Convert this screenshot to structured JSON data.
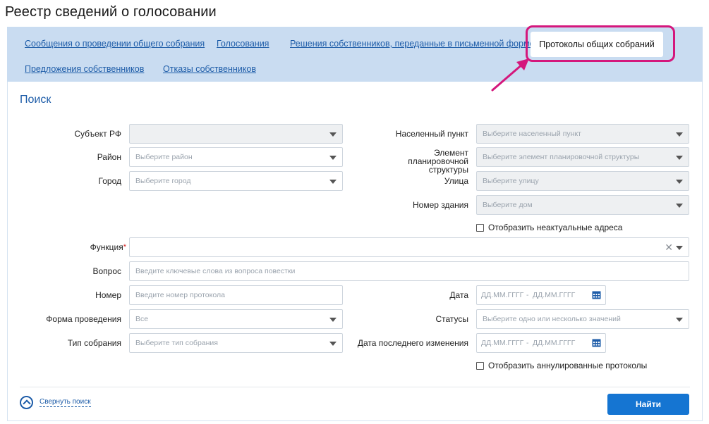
{
  "page": {
    "title": "Реестр сведений о голосовании"
  },
  "tabs": {
    "items": [
      {
        "label": "Сообщения о проведении общего собрания"
      },
      {
        "label": "Голосования"
      },
      {
        "label": "Решения собственников, переданные в письменной форме"
      },
      {
        "label": "Протоколы общих собраний",
        "active": true
      },
      {
        "label": "Предложения собственников"
      },
      {
        "label": "Отказы собственников"
      }
    ]
  },
  "search": {
    "title": "Поиск",
    "fields": {
      "subject": {
        "label": "Субъект РФ",
        "placeholder": ""
      },
      "district": {
        "label": "Район",
        "placeholder": "Выберите район"
      },
      "city": {
        "label": "Город",
        "placeholder": "Выберите город"
      },
      "settlement": {
        "label": "Населенный пункт",
        "placeholder": "Выберите населенный пункт"
      },
      "planning": {
        "label": "Элемент планировочной структуры",
        "placeholder": "Выберите элемент планировочной структуры"
      },
      "street": {
        "label": "Улица",
        "placeholder": "Выберите улицу"
      },
      "building": {
        "label": "Номер здания",
        "placeholder": "Выберите дом"
      },
      "function": {
        "label": "Функция",
        "required_mark": "*",
        "value": ""
      },
      "question": {
        "label": "Вопрос",
        "placeholder": "Введите ключевые слова из вопроса повестки"
      },
      "number": {
        "label": "Номер",
        "placeholder": "Введите номер протокола"
      },
      "date": {
        "label": "Дата",
        "from_placeholder": "ДД.ММ.ГГГГ",
        "separator": "-",
        "to_placeholder": "ДД.ММ.ГГГГ"
      },
      "form": {
        "label": "Форма проведения",
        "value": "Все"
      },
      "statuses": {
        "label": "Статусы",
        "placeholder": "Выберите одно или несколько значений"
      },
      "meeting_type": {
        "label": "Тип собрания",
        "placeholder": "Выберите тип собрания"
      },
      "last_change": {
        "label": "Дата последнего изменения",
        "from_placeholder": "ДД.ММ.ГГГГ",
        "separator": "-",
        "to_placeholder": "ДД.ММ.ГГГГ"
      }
    },
    "checkboxes": {
      "inactive_addresses": {
        "label": "Отобразить неактуальные адреса",
        "checked": false
      },
      "annulled_protocols": {
        "label": "Отобразить аннулированные протоколы",
        "checked": false
      }
    },
    "collapse_label": "Свернуть поиск",
    "submit_label": "Найти"
  },
  "colors": {
    "accent": "#1d5ca8",
    "tabs_bg": "#c9dcf1",
    "button_bg": "#1575d2",
    "highlight": "#d4177c"
  },
  "icons": {
    "caret": "chevron-down-icon",
    "clear": "close-icon",
    "calendar": "calendar-icon",
    "collapse": "chevron-up-circle-icon"
  }
}
